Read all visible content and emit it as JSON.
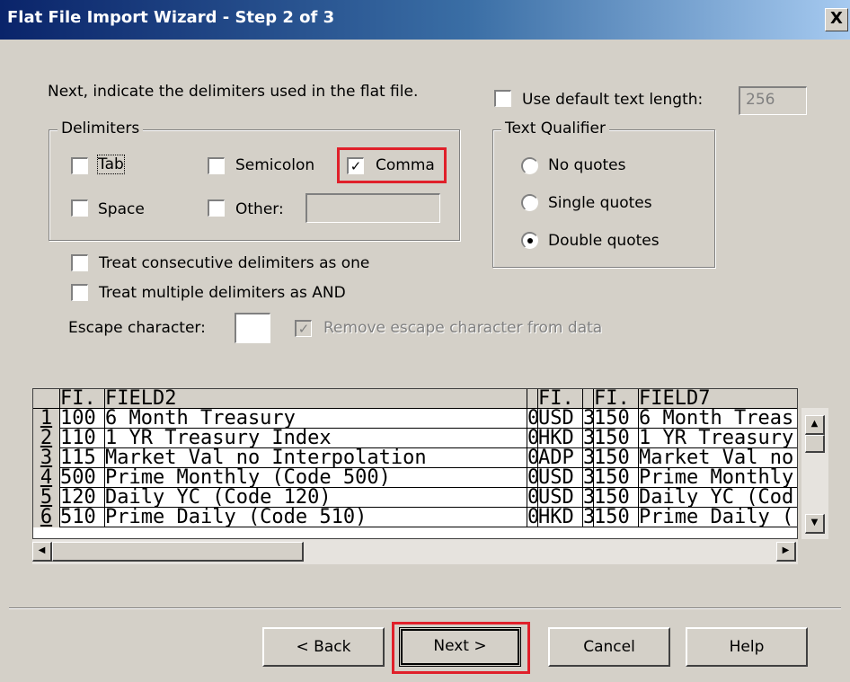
{
  "window": {
    "title": "Flat File Import Wizard - Step 2 of 3",
    "close_label": "X"
  },
  "instruction": "Next, indicate the delimiters used in the flat file.",
  "default_text_length": {
    "label": "Use default text length:",
    "checked": false,
    "value": "256"
  },
  "delimiters": {
    "legend": "Delimiters",
    "tab": {
      "label": "Tab",
      "checked": false
    },
    "semicolon": {
      "label": "Semicolon",
      "checked": false
    },
    "comma": {
      "label": "Comma",
      "checked": true
    },
    "space": {
      "label": "Space",
      "checked": false
    },
    "other": {
      "label": "Other:",
      "checked": false,
      "value": ""
    }
  },
  "text_qualifier": {
    "legend": "Text Qualifier",
    "options": [
      "No quotes",
      "Single quotes",
      "Double quotes"
    ],
    "selected": "Double quotes"
  },
  "options": {
    "treat_consecutive": {
      "label": "Treat consecutive delimiters as one",
      "checked": false
    },
    "treat_multiple": {
      "label": "Treat multiple delimiters as AND",
      "checked": false
    },
    "escape_label": "Escape character:",
    "escape_value": "",
    "remove_escape": {
      "label": "Remove escape character from data",
      "checked": true,
      "disabled": true
    }
  },
  "preview": {
    "headers": [
      "FI.",
      "FIELD2",
      "",
      "FI.",
      "",
      "FI.",
      "FIELD7"
    ],
    "rows": [
      [
        "1",
        "100",
        "6 Month Treasury",
        "0",
        "USD",
        "3",
        "150",
        "6 Month Treas"
      ],
      [
        "2",
        "110",
        "1 YR Treasury Index",
        "0",
        "HKD",
        "3",
        "150",
        "1 YR Treasury"
      ],
      [
        "3",
        "115",
        "Market Val no Interpolation",
        "0",
        "ADP",
        "3",
        "150",
        "Market Val no"
      ],
      [
        "4",
        "500",
        "Prime Monthly (Code 500)",
        "0",
        "USD",
        "3",
        "150",
        "Prime Monthly"
      ],
      [
        "5",
        "120",
        "Daily YC (Code 120)",
        "0",
        "USD",
        "3",
        "150",
        "Daily YC (Cod"
      ],
      [
        "6",
        "510",
        "Prime Daily (Code 510)",
        "0",
        "HKD",
        "3",
        "150",
        "Prime Daily ("
      ]
    ]
  },
  "buttons": {
    "back": "< Back",
    "next": "Next >",
    "cancel": "Cancel",
    "help": "Help"
  },
  "colors": {
    "dialog_bg": "#d4d0c8",
    "title_start": "#0a246a",
    "title_end": "#a6caf0",
    "highlight": "#e0202a"
  }
}
